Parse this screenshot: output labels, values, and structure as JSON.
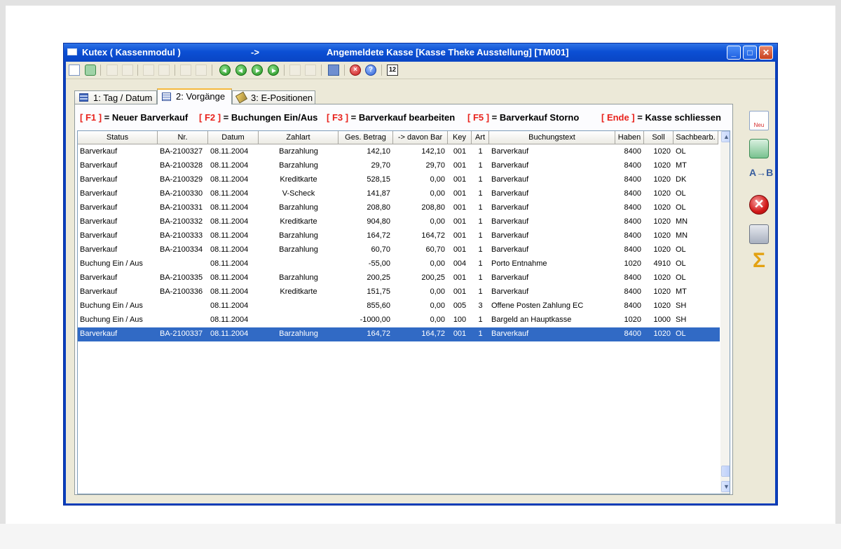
{
  "window": {
    "title_app": "Kutex ( Kassenmodul )",
    "title_arrow": "->",
    "title_register": "Angemeldete Kasse [Kasse Theke Ausstellung] [TM001]",
    "minimize_glyph": "_",
    "maximize_glyph": "□",
    "close_glyph": "✕"
  },
  "toolbar": {
    "icons": [
      "new-document-icon",
      "recycle-icon",
      "first-record-icon",
      "previous-record-icon",
      "next-record-icon",
      "last-record-icon",
      "book-icon",
      "cancel-icon",
      "help-icon",
      "calendar-icon"
    ],
    "help_glyph": "?",
    "cancel_glyph": "×",
    "calendar_label": "12"
  },
  "tabs": [
    {
      "label": "1: Tag / Datum",
      "icon": "table-icon"
    },
    {
      "label": "2: Vorgänge",
      "icon": "list-icon"
    },
    {
      "label": "3: E-Positionen",
      "icon": "label-tag-icon"
    }
  ],
  "hotkeys": [
    {
      "key": "[ F1 ]",
      "desc": " = Neuer Barverkauf"
    },
    {
      "key": "[ F2 ]",
      "desc": " = Buchungen Ein/Aus"
    },
    {
      "key": "[ F3 ]",
      "desc": " = Barverkauf bearbeiten"
    },
    {
      "key": "[ F5 ]",
      "desc": " = Barverkauf Storno"
    },
    {
      "key": "[ Ende ]",
      "desc": " = Kasse schliessen"
    }
  ],
  "table": {
    "columns": [
      "Status",
      "Nr.",
      "Datum",
      "Zahlart",
      "Ges. Betrag",
      "-> davon Bar",
      "Key",
      "Art",
      "Buchungstext",
      "Haben",
      "Soll",
      "Sachbearb."
    ],
    "rows": [
      [
        "Barverkauf",
        "BA-2100327",
        "08.11.2004",
        "Barzahlung",
        "142,10",
        "142,10",
        "001",
        "1",
        "Barverkauf",
        "8400",
        "1020",
        "OL"
      ],
      [
        "Barverkauf",
        "BA-2100328",
        "08.11.2004",
        "Barzahlung",
        "29,70",
        "29,70",
        "001",
        "1",
        "Barverkauf",
        "8400",
        "1020",
        "MT"
      ],
      [
        "Barverkauf",
        "BA-2100329",
        "08.11.2004",
        "Kreditkarte",
        "528,15",
        "0,00",
        "001",
        "1",
        "Barverkauf",
        "8400",
        "1020",
        "DK"
      ],
      [
        "Barverkauf",
        "BA-2100330",
        "08.11.2004",
        "V-Scheck",
        "141,87",
        "0,00",
        "001",
        "1",
        "Barverkauf",
        "8400",
        "1020",
        "OL"
      ],
      [
        "Barverkauf",
        "BA-2100331",
        "08.11.2004",
        "Barzahlung",
        "208,80",
        "208,80",
        "001",
        "1",
        "Barverkauf",
        "8400",
        "1020",
        "OL"
      ],
      [
        "Barverkauf",
        "BA-2100332",
        "08.11.2004",
        "Kreditkarte",
        "904,80",
        "0,00",
        "001",
        "1",
        "Barverkauf",
        "8400",
        "1020",
        "MN"
      ],
      [
        "Barverkauf",
        "BA-2100333",
        "08.11.2004",
        "Barzahlung",
        "164,72",
        "164,72",
        "001",
        "1",
        "Barverkauf",
        "8400",
        "1020",
        "MN"
      ],
      [
        "Barverkauf",
        "BA-2100334",
        "08.11.2004",
        "Barzahlung",
        "60,70",
        "60,70",
        "001",
        "1",
        "Barverkauf",
        "8400",
        "1020",
        "OL"
      ],
      [
        "Buchung Ein / Aus",
        "",
        "08.11.2004",
        "",
        "-55,00",
        "0,00",
        "004",
        "1",
        "Porto Entnahme",
        "1020",
        "4910",
        "OL"
      ],
      [
        "Barverkauf",
        "BA-2100335",
        "08.11.2004",
        "Barzahlung",
        "200,25",
        "200,25",
        "001",
        "1",
        "Barverkauf",
        "8400",
        "1020",
        "OL"
      ],
      [
        "Barverkauf",
        "BA-2100336",
        "08.11.2004",
        "Kreditkarte",
        "151,75",
        "0,00",
        "001",
        "1",
        "Barverkauf",
        "8400",
        "1020",
        "MT"
      ],
      [
        "Buchung Ein / Aus",
        "",
        "08.11.2004",
        "",
        "855,60",
        "0,00",
        "005",
        "3",
        "Offene Posten Zahlung EC",
        "8400",
        "1020",
        "SH"
      ],
      [
        "Buchung Ein / Aus",
        "",
        "08.11.2004",
        "",
        "-1000,00",
        "0,00",
        "100",
        "1",
        "Bargeld an Hauptkasse",
        "1020",
        "1000",
        "SH"
      ],
      [
        "Barverkauf",
        "BA-2100337",
        "08.11.2004",
        "Barzahlung",
        "164,72",
        "164,72",
        "001",
        "1",
        "Barverkauf",
        "8400",
        "1020",
        "OL"
      ]
    ],
    "selected_row": 13
  },
  "scrollbar": {
    "up_glyph": "▲",
    "down_glyph": "▼"
  },
  "side_toolbar": {
    "icons": [
      "new-document-icon",
      "recycle-icon",
      "swap-ab-icon",
      "cancel-icon",
      "printer-icon",
      "sum-icon"
    ],
    "new_label": "Neu",
    "ab_label": "A→B",
    "cancel_glyph": "✕",
    "sigma_glyph": "Σ"
  },
  "colors": {
    "hotkey_red": "#e8221c",
    "selection_blue": "#316ac5",
    "titlebar_blue": "#0b4fd4"
  }
}
